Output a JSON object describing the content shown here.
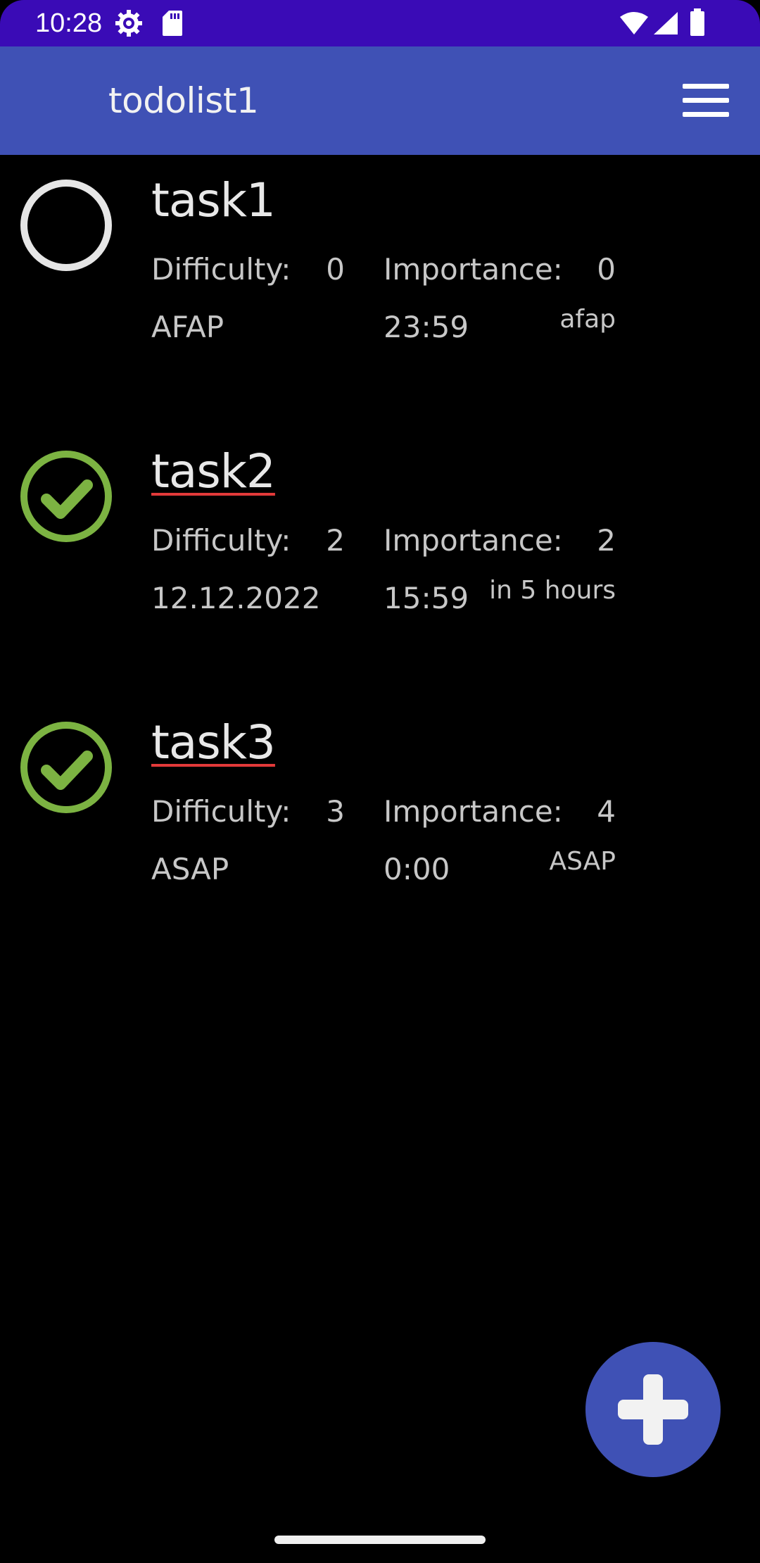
{
  "status_bar": {
    "time": "10:28",
    "icons": [
      "settings-icon",
      "sd-card-icon",
      "wifi-icon",
      "signal-icon",
      "battery-icon"
    ]
  },
  "app_bar": {
    "title": "todolist1",
    "menu_icon": "menu-icon"
  },
  "tasks": [
    {
      "name": "task1",
      "done": false,
      "difficulty_label": "Difficulty:",
      "difficulty": "0",
      "importance_label": "Importance:",
      "importance": "0",
      "date": "AFAP",
      "time": "23:59",
      "remaining": "afap"
    },
    {
      "name": "task2",
      "done": true,
      "difficulty_label": "Difficulty:",
      "difficulty": "2",
      "importance_label": "Importance:",
      "importance": "2",
      "date": "12.12.2022",
      "time": "15:59",
      "remaining": "in 5 hours"
    },
    {
      "name": "task3",
      "done": true,
      "difficulty_label": "Difficulty:",
      "difficulty": "3",
      "importance_label": "Importance:",
      "importance": "4",
      "date": "ASAP",
      "time": "0:00",
      "remaining": "ASAP"
    }
  ],
  "fab": {
    "icon": "plus-icon"
  },
  "colors": {
    "status_bar": "#3a0bb6",
    "app_bar": "#3f51b5",
    "check_done": "#7cb342",
    "check_open": "#e6e6e6",
    "strike_underline": "#e23a3a",
    "background": "#000000"
  }
}
